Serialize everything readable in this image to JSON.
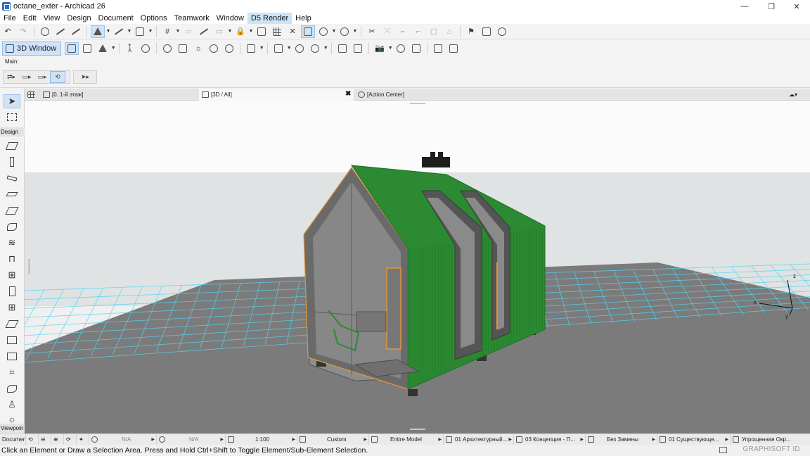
{
  "window": {
    "title": "octane_exter - Archicad 26",
    "controls": {
      "minimize": "—",
      "maximize": "❐",
      "close": "✕"
    }
  },
  "menu": {
    "items": [
      "File",
      "Edit",
      "View",
      "Design",
      "Document",
      "Options",
      "Teamwork",
      "Window",
      "D5 Render",
      "Help"
    ],
    "hovered": "D5 Render"
  },
  "toolbar2": {
    "window_3d_label": "3D Window"
  },
  "infobox": {
    "label": "Main:"
  },
  "toolbox": {
    "design_label": "Design",
    "viewpoint_label": "Viewpoin",
    "document_label": "Documen"
  },
  "tabs": {
    "floor_plan": "[0. 1-й этаж]",
    "view_3d": "[3D / All]",
    "action_center": "[Action Center]",
    "close_glyph": "✖"
  },
  "viewport": {
    "axis_labels": {
      "x": "x",
      "y": "y",
      "z": "z"
    },
    "colors": {
      "sky": "#fbfbfb",
      "horizon": "#dfe3e3",
      "floor": "#7b7b7b",
      "grid": "#56d3f2",
      "cladding": "#2b8a32",
      "frame": "#5c5c5c",
      "trim": "#e2963a"
    }
  },
  "statusbar": {
    "scale1": "N/A",
    "scale2": "N/A",
    "scale3": "1:100",
    "layer": "Custom",
    "model": "Entire Model",
    "structure": "01 Архитектурный...",
    "concept": "03 Концепция - П...",
    "override": "Без Замены",
    "renovation": "01 Существующе...",
    "mvo": "Упрощенная Окр..."
  },
  "hint": {
    "text": "Click an Element or Draw a Selection Area. Press and Hold Ctrl+Shift to Toggle Element/Sub-Element Selection.",
    "brand": "GRAPHISOFT ID"
  }
}
